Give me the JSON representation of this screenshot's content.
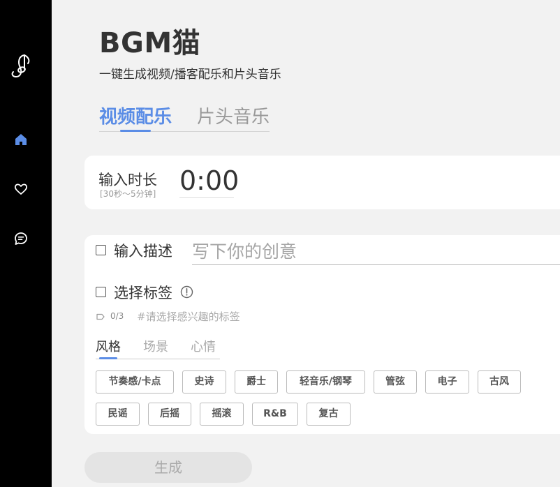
{
  "sidebar": {
    "logo": "music-note-logo",
    "items": [
      {
        "icon": "home-icon",
        "active": true
      },
      {
        "icon": "heart-icon",
        "active": false
      },
      {
        "icon": "chat-icon",
        "active": false
      }
    ]
  },
  "header": {
    "title": "BGM猫",
    "subtitle": "一键生成视频/播客配乐和片头音乐"
  },
  "tabs": [
    {
      "label": "视频配乐",
      "active": true
    },
    {
      "label": "片头音乐",
      "active": false
    }
  ],
  "duration": {
    "label": "输入时长",
    "hint": "[30秒～5分钟]",
    "value": "0:00"
  },
  "description": {
    "label": "输入描述",
    "placeholder": "写下你的创意",
    "checked": false
  },
  "tags": {
    "label": "选择标签",
    "checked": false,
    "count": "0/3",
    "hint": "#请选择感兴趣的标签",
    "categories": [
      {
        "label": "风格",
        "active": true
      },
      {
        "label": "场景",
        "active": false
      },
      {
        "label": "心情",
        "active": false
      }
    ],
    "items": [
      "节奏感/卡点",
      "史诗",
      "爵士",
      "轻音乐/钢琴",
      "管弦",
      "电子",
      "古风",
      "民谣",
      "后摇",
      "摇滚",
      "R&B",
      "复古"
    ]
  },
  "generate_label": "生成",
  "colors": {
    "accent": "#5b8de6",
    "sidebar_bg": "#000000",
    "page_bg": "#f2f2f2",
    "button_disabled_bg": "#e4e4e4"
  }
}
